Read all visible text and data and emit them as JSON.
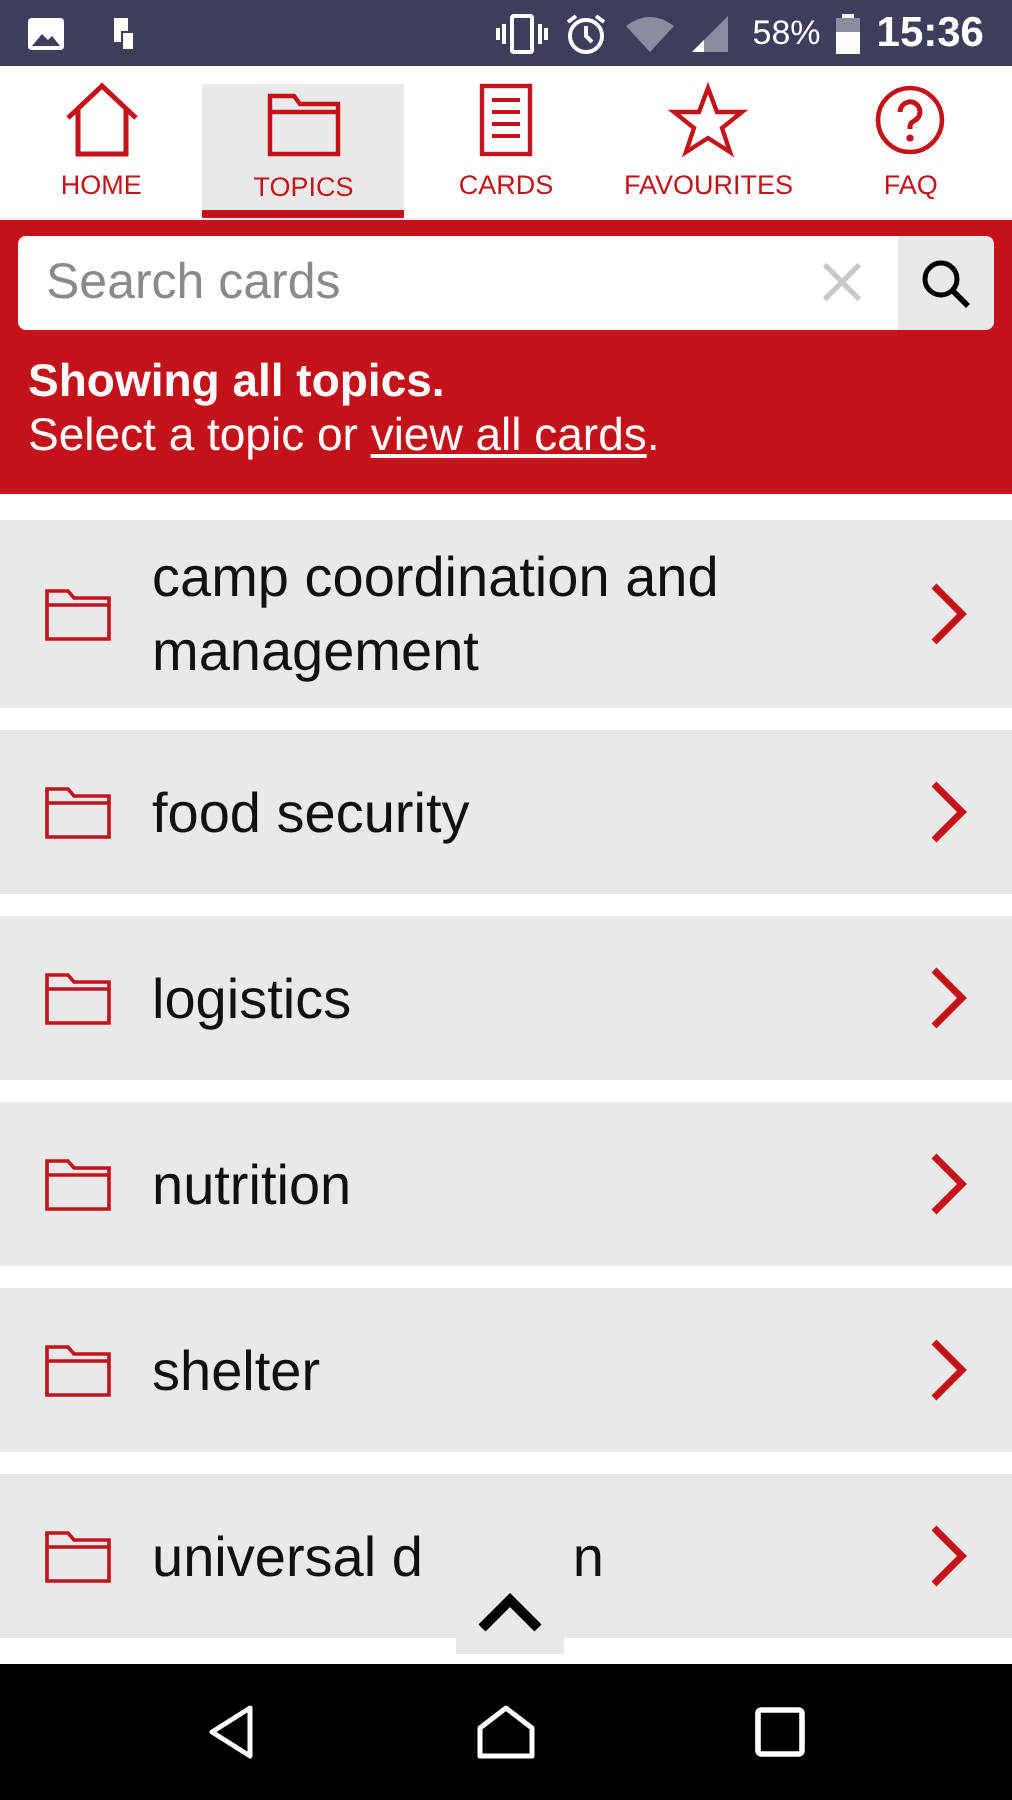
{
  "status_bar": {
    "battery": "58%",
    "time": "15:36"
  },
  "tabs": [
    {
      "label": "HOME",
      "kind": "home",
      "selected": false
    },
    {
      "label": "TOPICS",
      "kind": "folder",
      "selected": true
    },
    {
      "label": "CARDS",
      "kind": "document",
      "selected": false
    },
    {
      "label": "FAVOURITES",
      "kind": "star",
      "selected": false
    },
    {
      "label": "FAQ",
      "kind": "question",
      "selected": false
    }
  ],
  "search": {
    "placeholder": "Search cards"
  },
  "notice": {
    "title": "Showing all topics.",
    "text": "Select a topic or ",
    "link": "view all cards",
    "after": "."
  },
  "topics": [
    {
      "label": "camp coordination and management"
    },
    {
      "label": "food security"
    },
    {
      "label": "logistics"
    },
    {
      "label": "nutrition"
    },
    {
      "label": "shelter"
    },
    {
      "label": "universal d",
      "tail": "n"
    }
  ]
}
